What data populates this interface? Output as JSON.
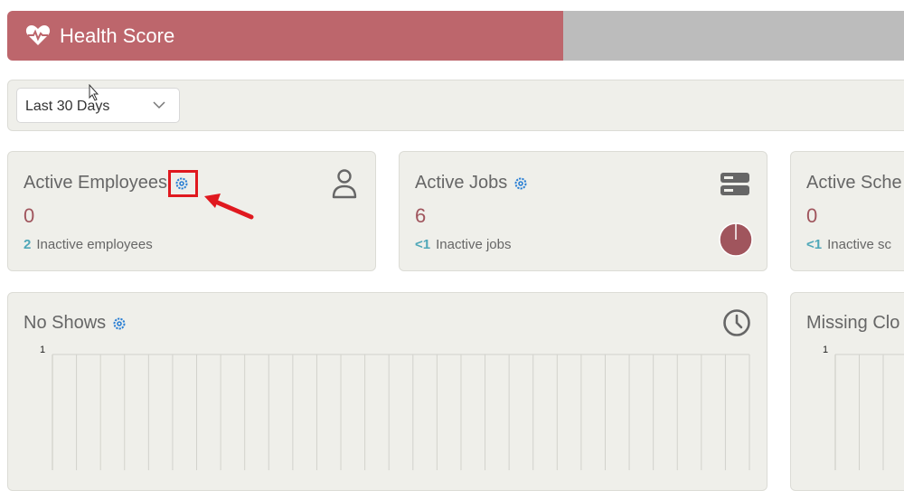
{
  "header": {
    "title": "Health Score",
    "icon": "heartbeat-icon",
    "accent": "#bd666c"
  },
  "filter": {
    "range_value": "Last 30 Days"
  },
  "cards": {
    "employees": {
      "title": "Active Employees",
      "value": "0",
      "sub_count": "2",
      "sub_label": "Inactive employees",
      "icon": "person-icon"
    },
    "jobs": {
      "title": "Active Jobs",
      "value": "6",
      "sub_count": "<1",
      "sub_label": "Inactive jobs",
      "icon": "server-icon"
    },
    "schedules": {
      "title": "Active Sche",
      "value": "0",
      "sub_count": "<1",
      "sub_label": "Inactive sc"
    }
  },
  "charts": {
    "no_shows": {
      "title": "No Shows",
      "icon": "clock-icon"
    },
    "missing": {
      "title": "Missing Clo"
    }
  },
  "chart_data": [
    {
      "type": "bar",
      "title": "No Shows",
      "yticks": [
        "1"
      ],
      "ylim": [
        0,
        1
      ],
      "categories_count": 30,
      "grid": true
    },
    {
      "type": "bar",
      "title": "Missing Clo",
      "yticks": [
        "1"
      ],
      "ylim": [
        0,
        1
      ],
      "grid": true
    }
  ],
  "colors": {
    "value": "#a0555d",
    "count": "#4fa7b8",
    "gear": "#2a7fd4",
    "highlight": "#e0191f"
  }
}
